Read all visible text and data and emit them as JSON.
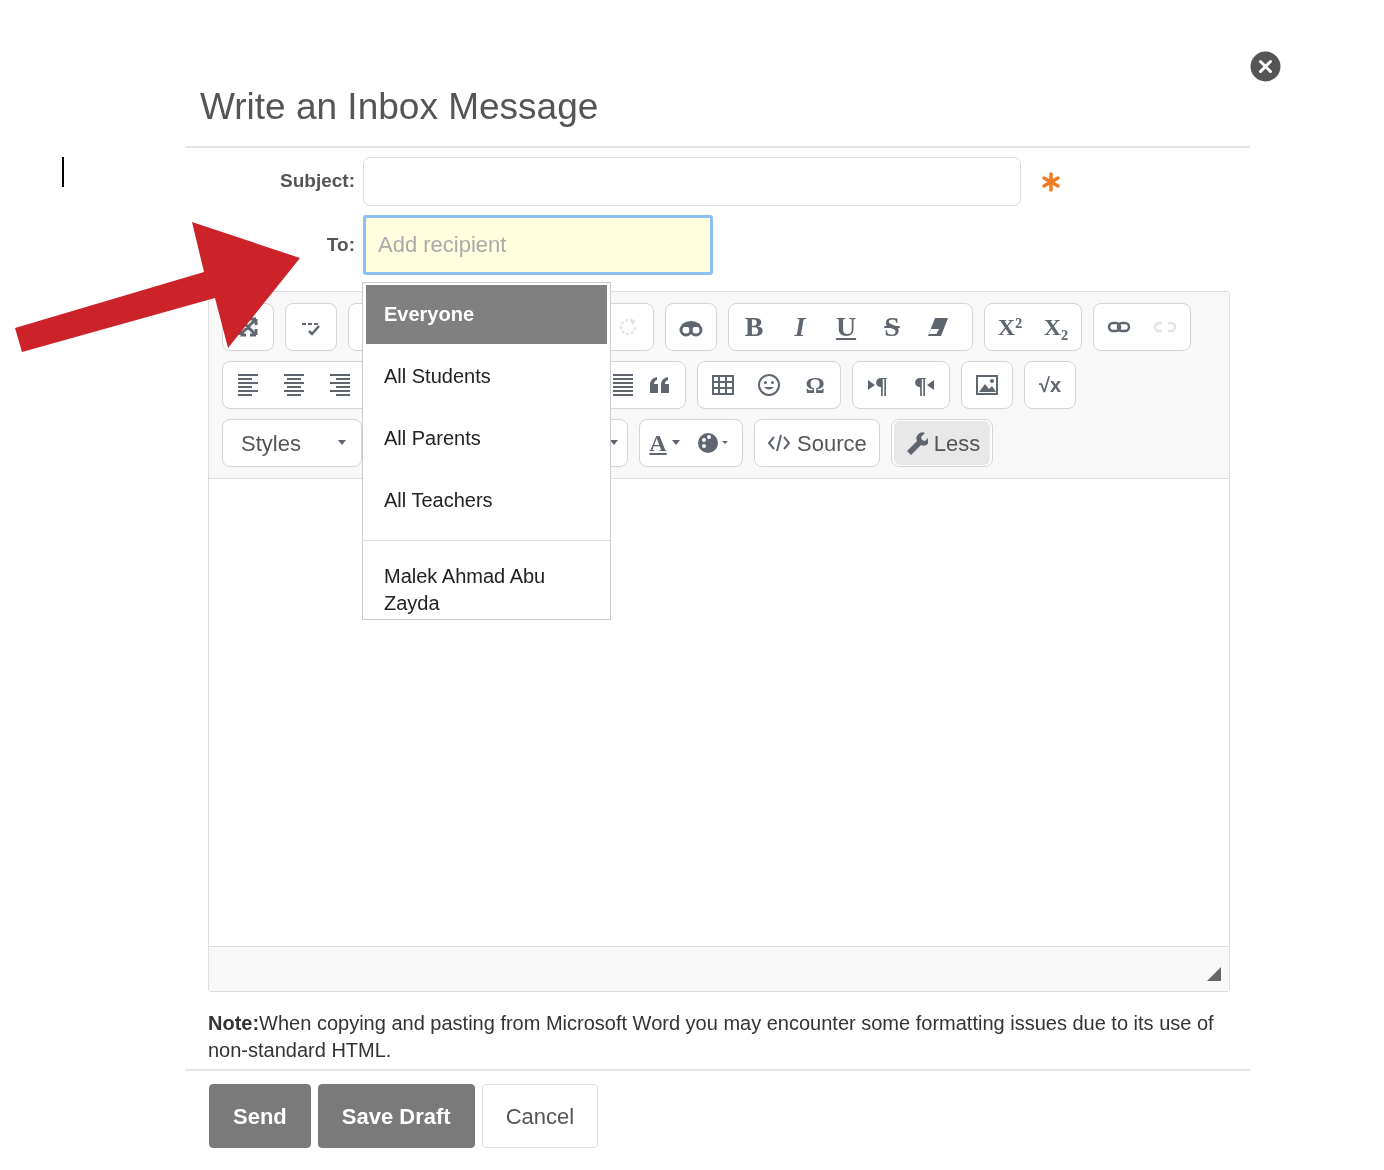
{
  "dialog": {
    "title": "Write an Inbox Message"
  },
  "subject": {
    "label": "Subject:",
    "required": true
  },
  "to": {
    "label": "To:",
    "placeholder": "Add recipient",
    "focused": true
  },
  "recipient_menu": {
    "groups": [
      {
        "items": [
          {
            "label": "Everyone",
            "selected": true
          },
          {
            "label": "All Students",
            "selected": false
          },
          {
            "label": "All Parents",
            "selected": false
          },
          {
            "label": "All Teachers",
            "selected": false
          }
        ]
      },
      {
        "items": [
          {
            "label": "Malek Ahmad Abu Zayda",
            "selected": false
          }
        ]
      }
    ]
  },
  "toolbar": {
    "rows": [
      {
        "groups": [
          {
            "buttons": [
              {
                "kind": "maximize",
                "disabled": false,
                "pressed": false
              }
            ]
          },
          {
            "buttons": [
              {
                "kind": "spellcheck",
                "disabled": false,
                "pressed": false
              }
            ]
          },
          {
            "buttons": [
              {
                "kind": "redo",
                "disabled": true,
                "pressed": false
              }
            ]
          },
          {
            "buttons": [
              {
                "kind": "find",
                "disabled": false,
                "pressed": false
              }
            ]
          },
          {
            "buttons": [
              {
                "kind": "bold",
                "text": "B",
                "disabled": false,
                "pressed": false
              },
              {
                "kind": "italic",
                "text": "I",
                "disabled": false,
                "pressed": false
              },
              {
                "kind": "underline",
                "text": "U",
                "disabled": false,
                "pressed": false
              },
              {
                "kind": "strike",
                "text": "S",
                "disabled": false,
                "pressed": false
              },
              {
                "kind": "eraser",
                "disabled": false,
                "pressed": false
              }
            ]
          },
          {
            "buttons": [
              {
                "kind": "superscript",
                "text": "X²",
                "disabled": false,
                "pressed": false
              },
              {
                "kind": "subscript",
                "text": "X₂",
                "disabled": false,
                "pressed": false
              }
            ]
          },
          {
            "buttons": [
              {
                "kind": "link",
                "disabled": false,
                "pressed": false
              },
              {
                "kind": "unlink",
                "disabled": true,
                "pressed": false
              }
            ]
          }
        ]
      },
      {
        "groups": [
          {
            "buttons": [
              {
                "kind": "alignleft",
                "disabled": false,
                "pressed": false
              },
              {
                "kind": "aligncenter",
                "disabled": false,
                "pressed": false
              },
              {
                "kind": "alignright",
                "disabled": false,
                "pressed": false
              },
              {
                "kind": "justify",
                "disabled": false,
                "pressed": false
              },
              {
                "kind": "blockquote",
                "disabled": false,
                "pressed": false
              }
            ]
          },
          {
            "buttons": [
              {
                "kind": "table",
                "disabled": false,
                "pressed": false
              },
              {
                "kind": "smiley",
                "disabled": false,
                "pressed": false
              },
              {
                "kind": "omega",
                "text": "Ω",
                "disabled": false,
                "pressed": false
              }
            ]
          },
          {
            "buttons": [
              {
                "kind": "ltr",
                "text": "¶",
                "disabled": false,
                "pressed": false
              },
              {
                "kind": "rtl",
                "text": "¶",
                "disabled": false,
                "pressed": false
              }
            ]
          },
          {
            "buttons": [
              {
                "kind": "image",
                "disabled": false,
                "pressed": false
              }
            ]
          },
          {
            "buttons": [
              {
                "kind": "math",
                "text": "√x",
                "disabled": false,
                "pressed": false
              }
            ]
          }
        ]
      },
      {
        "groups": [
          {
            "buttons": [
              {
                "kind": "combo",
                "text": "Styles",
                "disabled": false,
                "pressed": false
              }
            ]
          },
          {
            "buttons": [
              {
                "kind": "combo",
                "disabled": false,
                "pressed": false
              }
            ]
          },
          {
            "buttons": [
              {
                "kind": "textcolor",
                "text": "A",
                "disabled": false,
                "pressed": false
              },
              {
                "kind": "bgcolor",
                "disabled": false,
                "pressed": false
              }
            ]
          },
          {
            "buttons": [
              {
                "kind": "source",
                "text": "Source",
                "disabled": false,
                "pressed": false
              }
            ]
          },
          {
            "buttons": [
              {
                "kind": "less",
                "text": "Less",
                "disabled": false,
                "pressed": true
              }
            ]
          }
        ]
      }
    ]
  },
  "note": "**Note:**When copying and pasting from Microsoft Word you may encounter some formatting issues due to its use of non-standard HTML.",
  "buttons": [
    {
      "label": "Send",
      "kind": "primary"
    },
    {
      "label": "Save Draft",
      "kind": "primary"
    },
    {
      "label": "Cancel",
      "kind": "secondary"
    }
  ]
}
